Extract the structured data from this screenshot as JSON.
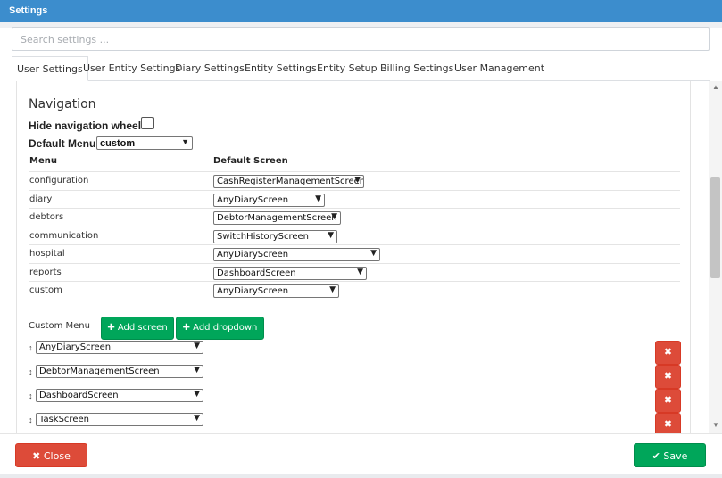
{
  "window": {
    "title": "Settings"
  },
  "search": {
    "placeholder": "Search settings ..."
  },
  "tabs": [
    {
      "label": "User Settings",
      "active": true
    },
    {
      "label": "User Entity Settings"
    },
    {
      "label": "Diary Settings"
    },
    {
      "label": "Entity Settings"
    },
    {
      "label": "Entity Setup"
    },
    {
      "label": "Billing Settings"
    },
    {
      "label": "User Management"
    }
  ],
  "navigation": {
    "heading": "Navigation",
    "hide_wheel_label": "Hide navigation wheel",
    "hide_wheel_checked": false,
    "default_menu_label": "Default Menu",
    "default_menu_value": "custom"
  },
  "table": {
    "headers": {
      "menu": "Menu",
      "default_screen": "Default Screen"
    },
    "rows": [
      {
        "menu": "configuration",
        "screen": "CashRegisterManagementScreen"
      },
      {
        "menu": "diary",
        "screen": "AnyDiaryScreen"
      },
      {
        "menu": "debtors",
        "screen": "DebtorManagementScreen"
      },
      {
        "menu": "communication",
        "screen": "SwitchHistoryScreen"
      },
      {
        "menu": "hospital",
        "screen": "AnyDiaryScreen"
      },
      {
        "menu": "reports",
        "screen": "DashboardScreen"
      },
      {
        "menu": "custom",
        "screen": "AnyDiaryScreen"
      }
    ]
  },
  "custom_menu": {
    "label": "Custom Menu",
    "add_screen_label": "Add screen",
    "add_dropdown_label": "Add dropdown",
    "items": [
      {
        "screen": "AnyDiaryScreen"
      },
      {
        "screen": "DebtorManagementScreen"
      },
      {
        "screen": "DashboardScreen"
      },
      {
        "screen": "TaskScreen"
      }
    ]
  },
  "footer": {
    "close_label": "Close",
    "save_label": "Save"
  },
  "icons": {
    "plus": "plus-icon",
    "delete": "times-icon",
    "sort": "sort-icon",
    "close": "times-circle-icon",
    "save": "check-circle-icon"
  },
  "colors": {
    "titlebar": "#3c8dcd",
    "success": "#00a65a",
    "danger": "#dd4b39"
  }
}
